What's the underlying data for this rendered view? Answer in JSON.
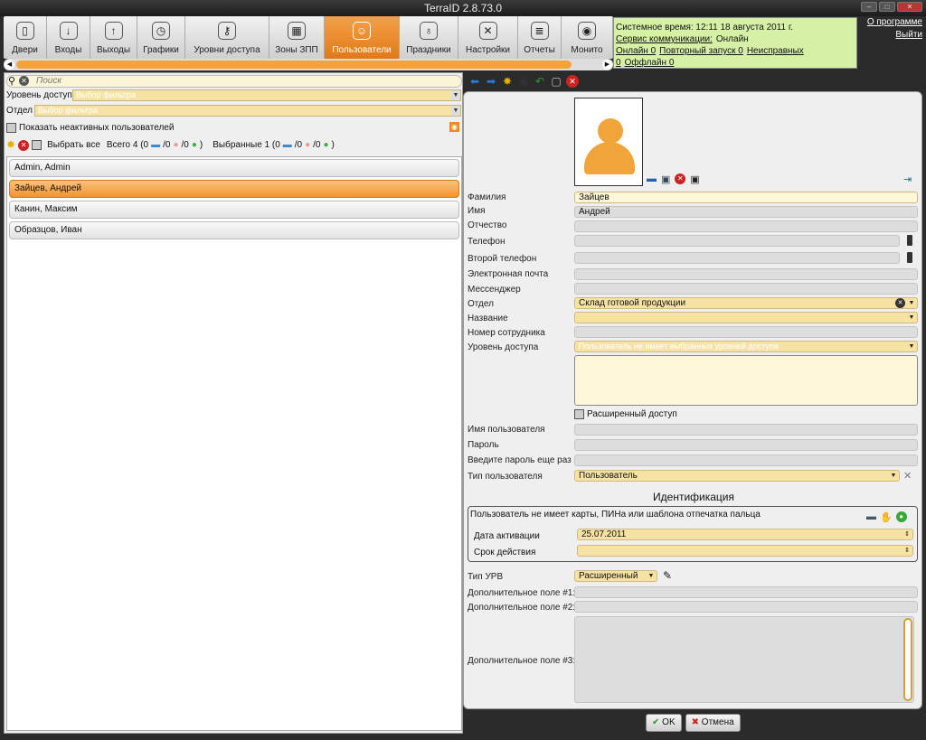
{
  "window": {
    "title": "TerraID 2.8.73.0"
  },
  "tabs": [
    {
      "label": "Двери",
      "icon": "door-icon"
    },
    {
      "label": "Входы",
      "icon": "entrance-icon"
    },
    {
      "label": "Выходы",
      "icon": "exit-icon"
    },
    {
      "label": "Графики",
      "icon": "clock-icon"
    },
    {
      "label": "Уровни доступа",
      "icon": "access-levels-icon"
    },
    {
      "label": "Зоны ЗПП",
      "icon": "zones-icon"
    },
    {
      "label": "Пользователи",
      "icon": "users-icon"
    },
    {
      "label": "Праздники",
      "icon": "balloons-icon"
    },
    {
      "label": "Настройки",
      "icon": "tools-icon"
    },
    {
      "label": "Отчеты",
      "icon": "report-icon"
    },
    {
      "label": "Монито",
      "icon": "eye-icon"
    }
  ],
  "status": {
    "system_time": "Системное время: 12:11 18 августа 2011 г.",
    "service_label": "Сервис коммуникации:",
    "service_value": "Онлайн",
    "online": "Онлайн 0",
    "restart": "Повторный запуск 0",
    "faulty": "Неисправных 0",
    "offline": "Оффлайн 0"
  },
  "top_links": {
    "about": "О программе",
    "exit": "Выйти"
  },
  "left": {
    "search_placeholder": "Поиск",
    "access_level_label": "Уровень доступа",
    "access_level_value": "Выбор фильтра",
    "department_label": "Отдел",
    "department_value": "Выбор фильтра",
    "show_inactive": "Показать неактивных пользователей",
    "select_all": "Выбрать все",
    "total": "Всего 4 (0",
    "total_mid": "/0",
    "total_end": "/0",
    "total_close": ")",
    "selected": "Выбранные 1 (0",
    "selected_mid": "/0",
    "selected_end": "/0",
    "selected_close": ")",
    "users": [
      "Admin, Admin",
      "Зайцев, Андрей",
      "Канин, Максим",
      "Образцов, Иван"
    ]
  },
  "form": {
    "last_name_label": "Фамилия",
    "last_name": "Зайцев",
    "first_name_label": "Имя",
    "first_name": "Андрей",
    "middle_name_label": "Отчество",
    "middle_name": "",
    "phone_label": "Телефон",
    "phone": "",
    "phone2_label": "Второй телефон",
    "phone2": "",
    "email_label": "Электронная почта",
    "email": "",
    "messenger_label": "Мессенджер",
    "messenger": "",
    "department_label": "Отдел",
    "department": "Склад готовой продукции",
    "title_label": "Название",
    "title": "",
    "employee_no_label": "Номер сотрудника",
    "employee_no": "",
    "access_level_label": "Уровень доступа",
    "access_level": "Пользователь не имеет выбранных уровней доступа",
    "extended_access": "Расширенный доступ",
    "username_label": "Имя пользователя",
    "username": "",
    "password_label": "Пароль",
    "password": "",
    "password2_label": "Введите пароль еще раз",
    "password2": "",
    "user_type_label": "Тип пользователя",
    "user_type": "Пользователь",
    "identification_title": "Идентификация",
    "no_card_text": "Пользователь не имеет карты, ПИНа или шаблона отпечатка пальца",
    "activation_label": "Дата активации",
    "activation": "25.07.2011",
    "expiry_label": "Срок действия",
    "expiry": "",
    "urv_type_label": "Тип УРВ",
    "urv_type": "Расширенный",
    "extra1_label": "Дополнительное поле #1:",
    "extra2_label": "Дополнительное поле #2:",
    "extra3_label": "Дополнительное поле #3:"
  },
  "buttons": {
    "ok": "OK",
    "cancel": "Отмена"
  }
}
